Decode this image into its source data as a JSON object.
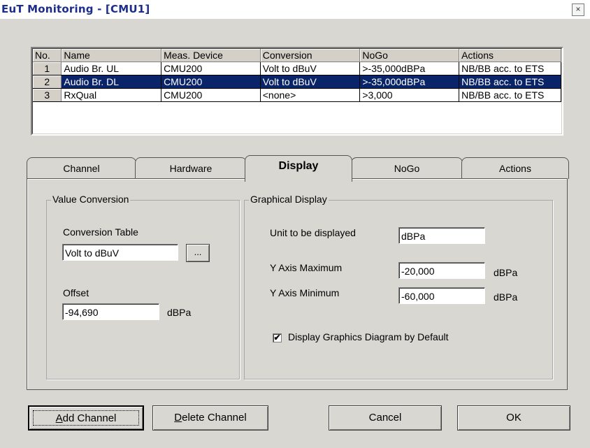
{
  "window": {
    "title": "EuT Monitoring - [CMU1]",
    "close_glyph": "×"
  },
  "grid": {
    "headers": [
      "No.",
      "Name",
      "Meas. Device",
      "Conversion",
      "NoGo",
      "Actions"
    ],
    "rows": [
      [
        "1",
        "Audio Br. UL",
        "CMU200",
        "Volt to dBuV",
        ">-35,000dBPa",
        "NB/BB acc. to ETS"
      ],
      [
        "2",
        "Audio Br. DL",
        "CMU200",
        "Volt to dBuV",
        ">-35,000dBPa",
        "NB/BB acc. to ETS"
      ],
      [
        "3",
        "RxQual",
        "CMU200",
        "<none>",
        ">3,000",
        "NB/BB acc. to ETS"
      ]
    ],
    "selected_row": 2
  },
  "tabs": [
    "Channel",
    "Hardware",
    "Display",
    "NoGo",
    "Actions"
  ],
  "active_tab": "Display",
  "value_conversion": {
    "title": "Value Conversion",
    "table_label": "Conversion Table",
    "table_value": "Volt to dBuV",
    "browse_label": "...",
    "offset_label": "Offset",
    "offset_value": "-94,690",
    "offset_unit": "dBPa"
  },
  "graphical_display": {
    "title": "Graphical Display",
    "unit_label": "Unit to be displayed",
    "unit_value": "dBPa",
    "ymax_label": "Y Axis Maximum",
    "ymax_value": "-20,000",
    "ymax_unit": "dBPa",
    "ymin_label": "Y Axis Minimum",
    "ymin_value": "-60,000",
    "ymin_unit": "dBPa",
    "checkbox_label": "Display Graphics Diagram by Default",
    "checkbox_checked": "✔"
  },
  "buttons": {
    "add_mnemonic": "A",
    "add_rest": "dd Channel",
    "delete_mnemonic": "D",
    "delete_rest": "elete Channel",
    "cancel": "Cancel",
    "ok": "OK"
  }
}
